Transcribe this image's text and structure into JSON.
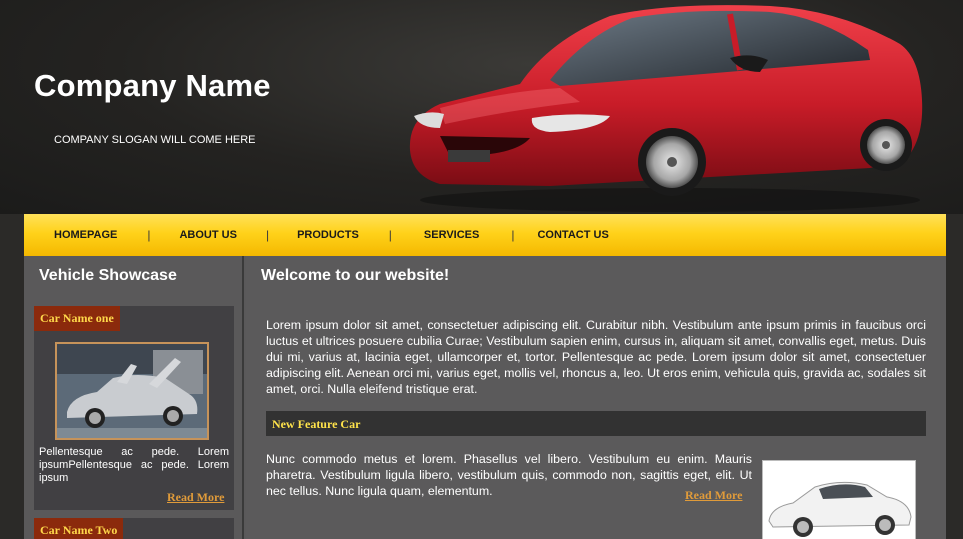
{
  "header": {
    "company_name": "Company Name",
    "slogan": "COMPANY SLOGAN WILL COME HERE"
  },
  "nav": {
    "items": [
      {
        "label": "HOMEPAGE"
      },
      {
        "label": "ABOUT US"
      },
      {
        "label": "PRODUCTS"
      },
      {
        "label": "SERVICES"
      },
      {
        "label": "CONTACT US"
      }
    ],
    "separator": "|"
  },
  "sidebar": {
    "title": "Vehicle Showcase",
    "cars": [
      {
        "name": "Car Name one",
        "text": "Pellentesque ac pede. Lorem ipsumPellentesque ac pede. Lorem ipsum",
        "read_more": "Read More"
      },
      {
        "name": "Car Name Two"
      }
    ]
  },
  "content": {
    "title": "Welcome to our website!",
    "intro": "Lorem ipsum dolor sit amet, consectetuer adipiscing elit. Curabitur nibh. Vestibulum ante ipsum primis in faucibus orci luctus et ultrices posuere cubilia Curae; Vestibulum sapien enim, cursus in, aliquam sit amet, convallis eget, metus. Duis dui mi, varius at, lacinia eget, ullamcorper et, tortor. Pellentesque ac pede. Lorem ipsum dolor sit amet, consectetuer adipiscing elit. Aenean orci mi, varius eget, mollis vel, rhoncus a, leo. Ut eros enim, vehicula quis, gravida ac, sodales sit amet, orci. Nulla eleifend tristique erat.",
    "feature": {
      "title": "New Feature Car",
      "text": "Nunc commodo metus et lorem. Phasellus vel libero. Vestibulum eu enim. Mauris pharetra. Vestibulum ligula libero, vestibulum quis, commodo non, sagittis eget, elit. Ut nec tellus. Nunc ligula quam, elementum.",
      "read_more": "Read More"
    }
  },
  "colors": {
    "nav_yellow": "#ffd21a",
    "car_label_bg": "#8b2a0c",
    "car_label_text": "#ffd84a",
    "read_more": "#e09b3a",
    "feature_title": "#ffe34a"
  }
}
